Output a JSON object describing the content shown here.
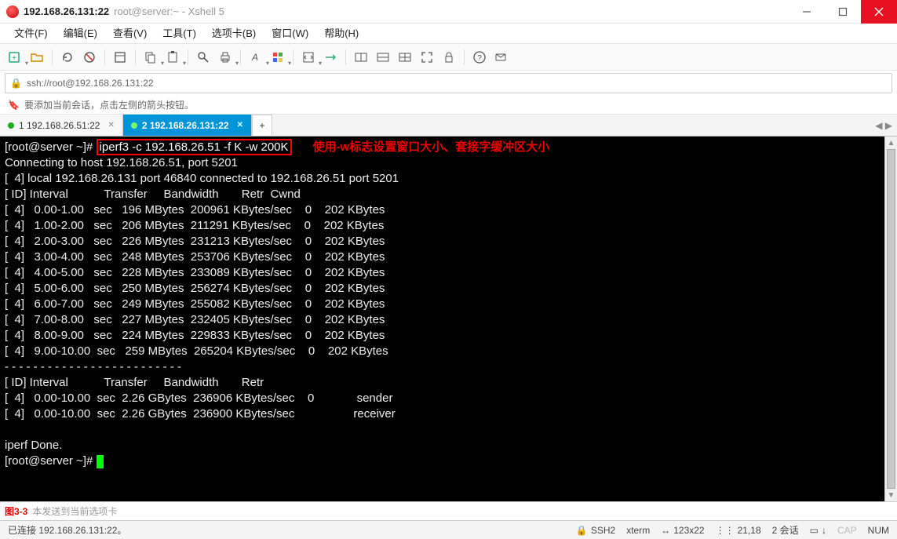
{
  "titlebar": {
    "title_main": "192.168.26.131:22",
    "title_sub": "root@server:~ - Xshell 5"
  },
  "menu": {
    "file": "文件(F)",
    "edit": "编辑(E)",
    "view": "查看(V)",
    "tools": "工具(T)",
    "tabs": "选项卡(B)",
    "window": "窗口(W)",
    "help": "帮助(H)"
  },
  "addrbar": {
    "url": "ssh://root@192.168.26.131:22"
  },
  "hintbar": {
    "text": "要添加当前会话，点击左侧的箭头按钮。"
  },
  "tabs": {
    "t1_label": "1 192.168.26.51:22",
    "t2_label": "2 192.168.26.131:22",
    "add": "+"
  },
  "terminal": {
    "prompt1": "[root@server ~]# ",
    "command": "iperf3 -c 192.168.26.51 -f K -w 200K",
    "annotation": "使用-w标志设置窗口大小、套接字缓冲区大小",
    "line2": "Connecting to host 192.168.26.51, port 5201",
    "line3": "[  4] local 192.168.26.131 port 46840 connected to 192.168.26.51 port 5201",
    "hdr1": "[ ID] Interval           Transfer     Bandwidth       Retr  Cwnd",
    "rows": [
      "[  4]   0.00-1.00   sec   196 MBytes  200961 KBytes/sec    0    202 KBytes",
      "[  4]   1.00-2.00   sec   206 MBytes  211291 KBytes/sec    0    202 KBytes",
      "[  4]   2.00-3.00   sec   226 MBytes  231213 KBytes/sec    0    202 KBytes",
      "[  4]   3.00-4.00   sec   248 MBytes  253706 KBytes/sec    0    202 KBytes",
      "[  4]   4.00-5.00   sec   228 MBytes  233089 KBytes/sec    0    202 KBytes",
      "[  4]   5.00-6.00   sec   250 MBytes  256274 KBytes/sec    0    202 KBytes",
      "[  4]   6.00-7.00   sec   249 MBytes  255082 KBytes/sec    0    202 KBytes",
      "[  4]   7.00-8.00   sec   227 MBytes  232405 KBytes/sec    0    202 KBytes",
      "[  4]   8.00-9.00   sec   224 MBytes  229833 KBytes/sec    0    202 KBytes",
      "[  4]   9.00-10.00  sec   259 MBytes  265204 KBytes/sec    0    202 KBytes"
    ],
    "dashes": "- - - - - - - - - - - - - - - - - - - - - - - - -",
    "hdr2": "[ ID] Interval           Transfer     Bandwidth       Retr",
    "sum1": "[  4]   0.00-10.00  sec  2.26 GBytes  236906 KBytes/sec    0             sender",
    "sum2": "[  4]   0.00-10.00  sec  2.26 GBytes  236900 KBytes/sec                  receiver",
    "blank": "",
    "done": "iperf Done.",
    "prompt2": "[root@server ~]# "
  },
  "sendbar": {
    "label": "图3-3",
    "placeholder": "本发送到当前选项卡"
  },
  "statusbar": {
    "conn": "已连接 192.168.26.131:22。",
    "ssh": "SSH2",
    "term": "xterm",
    "size": "123x22",
    "pos": "21,18",
    "sessions": "2 会话",
    "cap": "CAP",
    "num": "NUM"
  }
}
